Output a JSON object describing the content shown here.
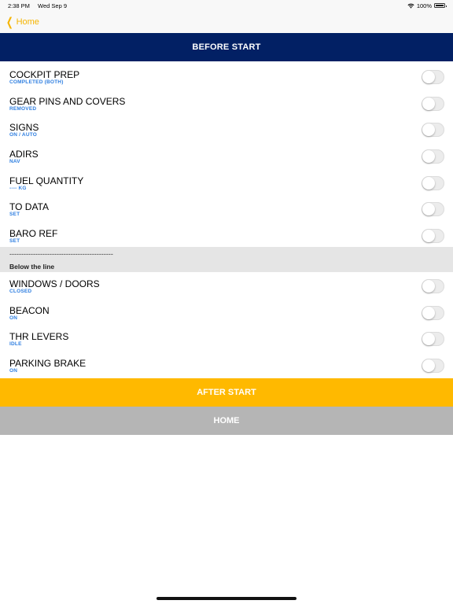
{
  "status_bar": {
    "time": "2:38 PM",
    "date": "Wed Sep 9",
    "battery": "100%"
  },
  "nav": {
    "back_label": "Home"
  },
  "title": "BEFORE START",
  "group1": [
    {
      "title": "COCKPIT PREP",
      "sub": "COMPLETED (BOTH)",
      "checked": false
    },
    {
      "title": "GEAR PINS AND COVERS",
      "sub": "REMOVED",
      "checked": false
    },
    {
      "title": "SIGNS",
      "sub": "ON / AUTO",
      "checked": false
    },
    {
      "title": "ADIRS",
      "sub": "NAV",
      "checked": false
    },
    {
      "title": "FUEL QUANTITY",
      "sub": "---- KG",
      "checked": false
    },
    {
      "title": "TO DATA",
      "sub": "SET",
      "checked": false
    },
    {
      "title": "BARO REF",
      "sub": "SET",
      "checked": false
    }
  ],
  "separator": {
    "dashes": "--------------------------------------------",
    "label": "Below the line"
  },
  "group2": [
    {
      "title": "WINDOWS / DOORS",
      "sub": "CLOSED",
      "checked": false
    },
    {
      "title": "BEACON",
      "sub": "ON",
      "checked": false
    },
    {
      "title": "THR LEVERS",
      "sub": "IDLE",
      "checked": false
    },
    {
      "title": "PARKING BRAKE",
      "sub": "ON",
      "checked": false
    }
  ],
  "buttons": {
    "after_start": "AFTER START",
    "home": "HOME"
  },
  "colors": {
    "navy": "#022064",
    "accent": "#ffb900",
    "sub_text": "#2e7ee0",
    "home_btn": "#b5b5b5"
  }
}
